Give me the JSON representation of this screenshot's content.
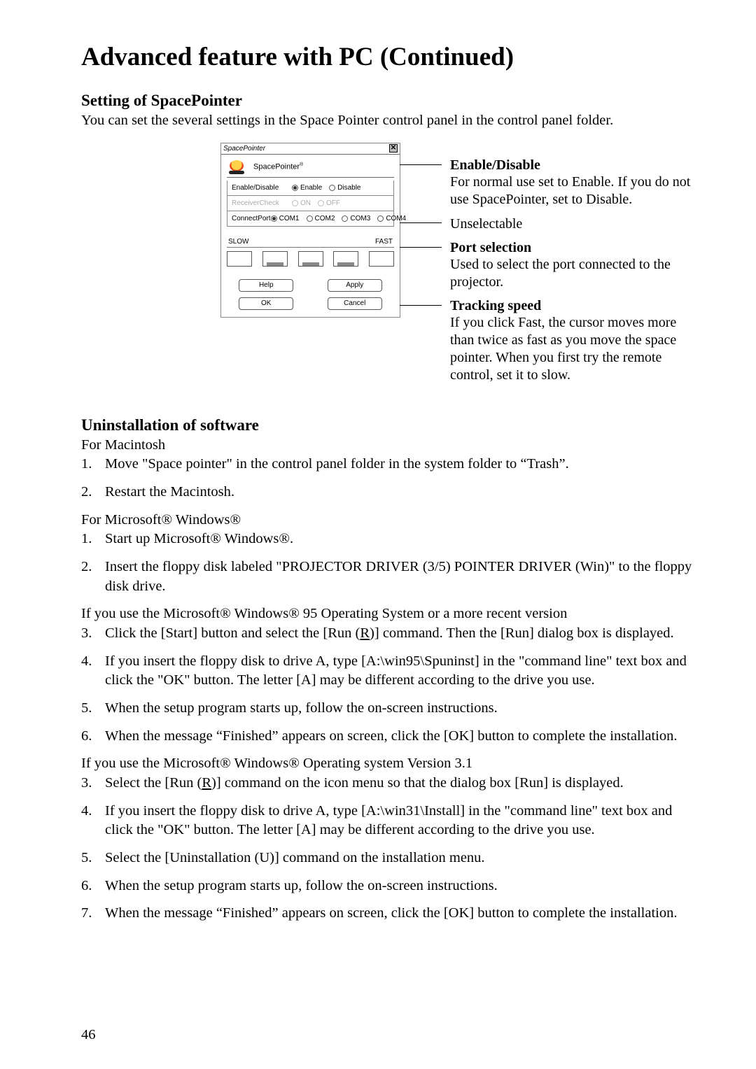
{
  "page": {
    "number": "46"
  },
  "heading": "Advanced feature with PC (Continued)",
  "spacepointer": {
    "section_title": "Setting of SpacePointer",
    "section_desc": "You can set the several settings in the Space Pointer control panel in the control panel folder.",
    "dialog": {
      "title": "SpacePointer",
      "brand": "SpacePointer",
      "brand_reg": "®",
      "rows": {
        "enable": {
          "label": "Enable/Disable",
          "opt1": "Enable",
          "opt2": "Disable"
        },
        "receiver": {
          "label": "ReceiverCheck",
          "opt1": "ON",
          "opt2": "OFF"
        },
        "port": {
          "label": "ConnectPort",
          "opt1": "COM1",
          "opt2": "COM2",
          "opt3": "COM3",
          "opt4": "COM4"
        }
      },
      "speed": {
        "slow": "SLOW",
        "fast": "FAST"
      },
      "buttons": {
        "help": "Help",
        "apply": "Apply",
        "ok": "OK",
        "cancel": "Cancel"
      }
    },
    "callouts": {
      "c1_title": "Enable/Disable",
      "c1_body": "For normal use set to Enable. If you do not use SpacePointer, set to Disable.",
      "c2_body": "Unselectable",
      "c3_title": "Port selection",
      "c3_body": "Used to select the port connected to the projector.",
      "c4_title": "Tracking speed",
      "c4_body": "If you click Fast, the cursor moves more than twice as fast as you move the space pointer. When you first try the remote control, set it to slow."
    }
  },
  "uninstall": {
    "title": "Uninstallation of software",
    "mac_header": "For Macintosh",
    "mac": {
      "s1_n": "1.",
      "s1": "Move \"Space pointer\" in the control panel folder in the system folder to “Trash”.",
      "s2_n": "2.",
      "s2": "Restart the Macintosh."
    },
    "win_header": "For Microsoft® Windows®",
    "win": {
      "s1_n": "1.",
      "s1": "Start up Microsoft® Windows®.",
      "s2_n": "2.",
      "s2": "Insert the floppy disk labeled \"PROJECTOR DRIVER (3/5) POINTER DRIVER (Win)\" to the floppy disk drive."
    },
    "win95_header": "If  you use the Microsoft® Windows® 95 Operating System or a more recent version",
    "win95": {
      "s3_n": "3.",
      "s3a": "Click the [Start] button and select the [Run (",
      "s3u": "R",
      "s3b": ")] command. Then the  [Run] dialog box is displayed.",
      "s4_n": "4.",
      "s4": "If you insert the floppy disk to drive A, type [A:\\win95\\Spuninst] in the \"command line\" text box and click the \"OK\" button. The letter [A] may be different according to the drive you use.",
      "s5_n": "5.",
      "s5": " When the setup program starts up, follow the on-screen instructions.",
      "s6_n": "6.",
      "s6": " When the message “Finished” appears on screen, click the [OK] button to complete the installation."
    },
    "win31_header": "If  you use the Microsoft® Windows® Operating system Version 3.1",
    "win31": {
      "s3_n": "3.",
      "s3a": "Select the [Run (",
      "s3u": "R",
      "s3b": ")] command on the icon menu so that the dialog box [Run] is displayed.",
      "s4_n": "4.",
      "s4": "If you insert the floppy disk to drive A, type [A:\\win31\\Install] in the \"command line\" text box and click the \"OK\" button. The letter [A] may be different according to the drive you use.",
      "s5_n": "5.",
      "s5": "Select the [Uninstallation (U)] command on the installation menu.",
      "s6_n": "6.",
      "s6": " When the setup program starts up, follow the on-screen instructions.",
      "s7_n": "7.",
      "s7": " When the message “Finished” appears on screen, click the [OK] button to complete the installation."
    }
  }
}
